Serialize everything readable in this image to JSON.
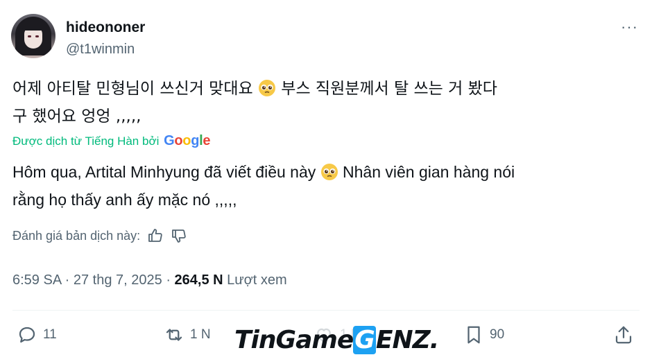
{
  "user": {
    "display_name": "hideononer",
    "handle": "@t1winmin"
  },
  "more_label": "···",
  "tweet": {
    "line1_part1": "어제 아티탈 민형님이 쓰신거 맞대요",
    "line1_part2": "부스 직원분께서 탈 쓰는 거 봤다",
    "line2": "구 했어요 엉엉 ,,,,,"
  },
  "translation": {
    "attribution": "Được dịch từ Tiếng Hàn bởi",
    "google_letters": [
      "G",
      "o",
      "o",
      "g",
      "l",
      "e"
    ],
    "line1_part1": "Hôm qua, Artital Minhyung đã viết điều này",
    "line1_part2": "Nhân viên gian hàng nói",
    "line2": "rằng họ thấy anh ấy mặc nó ,,,,,",
    "rate_label": "Đánh giá bản dịch này:"
  },
  "meta": {
    "time": "6:59 SA",
    "date": "27 thg 7, 2025",
    "separator": "·",
    "views_count": "264,5 N",
    "views_label": "Lượt xem"
  },
  "actions": {
    "replies": "11",
    "reposts": "1 N",
    "likes": "1 N",
    "bookmarks": "90"
  },
  "watermark": {
    "part1": "TinGame",
    "part2": "G",
    "part3": "ENZ."
  },
  "colors": {
    "text": "#0f1419",
    "secondary": "#536471",
    "translate_green": "#00ba7c",
    "divider": "#eff3f4"
  },
  "icons": [
    "more-icon",
    "pleading-face-emoji",
    "thumbs-up-icon",
    "thumbs-down-icon",
    "reply-icon",
    "repost-icon",
    "like-icon",
    "bookmark-icon",
    "share-icon"
  ]
}
